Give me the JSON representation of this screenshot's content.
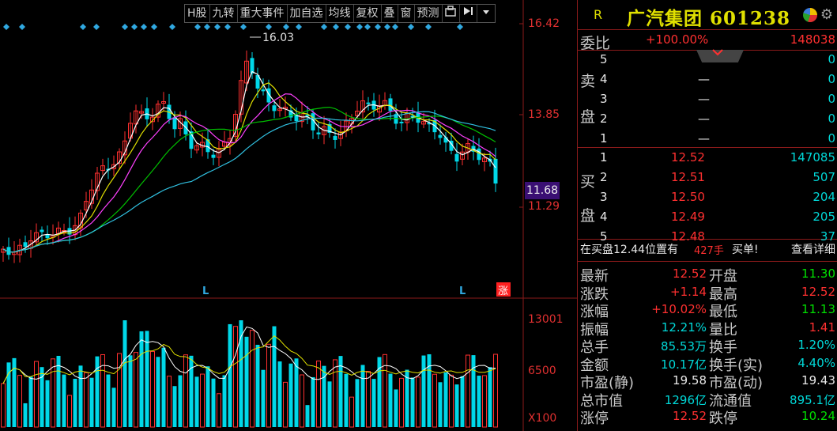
{
  "toolbar": {
    "items": [
      "H股",
      "九转",
      "重大事件",
      "加自选",
      "均线",
      "复权",
      "叠",
      "窗",
      "预测"
    ]
  },
  "chart": {
    "price_ticks": [
      "16.42",
      "13.85",
      "11.29"
    ],
    "current_price": "11.68",
    "high_annotation": "16.03",
    "volume_ticks": [
      "13001",
      "6500",
      "X100"
    ],
    "markers": [
      "L",
      "L",
      "涨"
    ]
  },
  "chart_data": [
    {
      "type": "candlestick",
      "title": "",
      "y_ticks": [
        "16.42",
        "13.85",
        "11.29"
      ],
      "annotations": [
        "16.03"
      ],
      "last_price_marker": "11.68",
      "series": [
        {
          "name": "",
          "color": "#ffffff"
        },
        {
          "name": "",
          "color": "#e0e000"
        },
        {
          "name": "",
          "color": "#ff40ff"
        },
        {
          "name": "",
          "color": "#00c000"
        },
        {
          "name": "",
          "color": "#30c0e0"
        }
      ]
    },
    {
      "type": "bar",
      "title": "",
      "y_ticks": [
        "13001",
        "6500"
      ],
      "unit": "X100"
    }
  ],
  "quote": {
    "header": {
      "prefix": "R",
      "name_code": "广汽集团 601238"
    },
    "webi": {
      "label": "委比",
      "pct": "+100.00%",
      "value": "148038"
    },
    "sell_label": [
      "卖",
      "盘"
    ],
    "sell": [
      {
        "level": "5",
        "price": "",
        "vol": "0"
      },
      {
        "level": "4",
        "price": "—",
        "vol": "0"
      },
      {
        "level": "3",
        "price": "—",
        "vol": "0"
      },
      {
        "level": "2",
        "price": "—",
        "vol": "0"
      },
      {
        "level": "1",
        "price": "—",
        "vol": "0"
      }
    ],
    "buy_label": [
      "买",
      "盘"
    ],
    "buy": [
      {
        "level": "1",
        "price": "12.52",
        "vol": "147085"
      },
      {
        "level": "2",
        "price": "12.51",
        "vol": "507"
      },
      {
        "level": "3",
        "price": "12.50",
        "vol": "204"
      },
      {
        "level": "4",
        "price": "12.49",
        "vol": "205"
      },
      {
        "level": "5",
        "price": "12.48",
        "vol": "37"
      }
    ],
    "notice": {
      "text": "在买盘12.44位置有",
      "hands": "427手",
      "action": "买单!",
      "link": "查看详细"
    },
    "stats": [
      {
        "l1": "最新",
        "v1": "12.52",
        "c1": "red",
        "l2": "开盘",
        "v2": "11.30",
        "c2": "green"
      },
      {
        "l1": "涨跌",
        "v1": "+1.14",
        "c1": "red",
        "l2": "最高",
        "v2": "12.52",
        "c2": "red"
      },
      {
        "l1": "涨幅",
        "v1": "+10.02%",
        "c1": "red",
        "l2": "最低",
        "v2": "11.13",
        "c2": "green"
      },
      {
        "l1": "振幅",
        "v1": "12.21%",
        "c1": "cyan",
        "l2": "量比",
        "v2": "1.41",
        "c2": "red"
      },
      {
        "l1": "总手",
        "v1": "85.53万",
        "c1": "cyan",
        "l2": "换手",
        "v2": "1.20%",
        "c2": "cyan"
      },
      {
        "l1": "金额",
        "v1": "10.17亿",
        "c1": "cyan",
        "l2": "换手(实)",
        "v2": "4.40%",
        "c2": "cyan"
      },
      {
        "l1": "市盈(静)",
        "v1": "19.58",
        "c1": "white",
        "l2": "市盈(动)",
        "v2": "19.43",
        "c2": "white"
      },
      {
        "l1": "总市值",
        "v1": "1296亿",
        "c1": "cyan",
        "l2": "流通值",
        "v2": "895.1亿",
        "c2": "cyan"
      },
      {
        "l1": "涨停",
        "v1": "12.52",
        "c1": "red",
        "l2": "跌停",
        "v2": "10.24",
        "c2": "green"
      }
    ]
  }
}
